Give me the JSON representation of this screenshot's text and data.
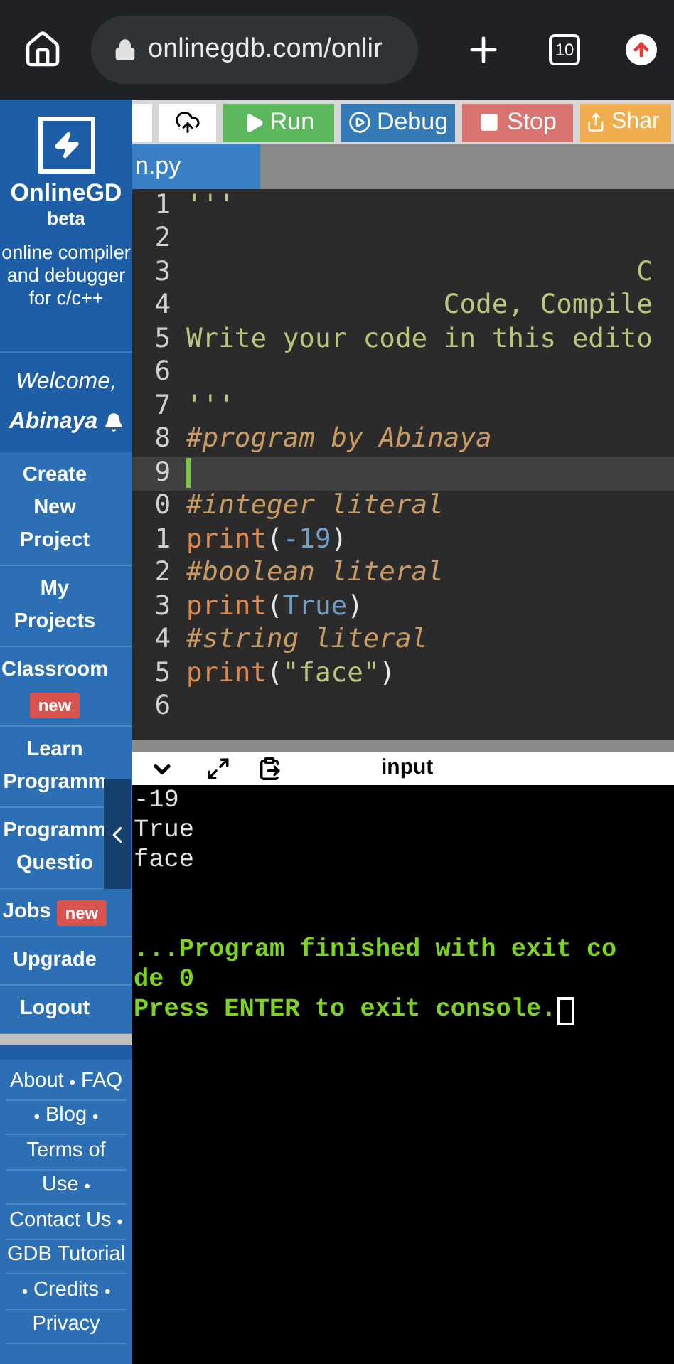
{
  "browser": {
    "url": "onlinegdb.com/onlir",
    "tab_count": "10"
  },
  "sidebar": {
    "logo_title": "OnlineGD",
    "logo_subtitle": "beta",
    "tagline": "online compiler and debugger for c/c++",
    "welcome": "Welcome,",
    "user": "Abinaya",
    "menu": [
      {
        "label": "Create New Project"
      },
      {
        "label": "My Projects"
      },
      {
        "label": "Classroom",
        "badge": "new",
        "badge_inline": false
      },
      {
        "label": "Learn Programm"
      },
      {
        "label": "Programm Questio"
      },
      {
        "label": "Jobs",
        "badge": "new",
        "badge_inline": true
      },
      {
        "label": "Upgrade"
      },
      {
        "label": "Logout"
      }
    ],
    "footer_lines": [
      [
        {
          "kind": "link",
          "text": "About"
        },
        {
          "kind": "sep",
          "text": "•"
        },
        {
          "kind": "link",
          "text": "FAQ"
        }
      ],
      [
        {
          "kind": "sep",
          "text": "•"
        },
        {
          "kind": "link",
          "text": "Blog"
        },
        {
          "kind": "sep",
          "text": "•"
        }
      ],
      [
        {
          "kind": "link",
          "text": "Terms of"
        }
      ],
      [
        {
          "kind": "link",
          "text": "Use"
        },
        {
          "kind": "sep",
          "text": "•"
        }
      ],
      [
        {
          "kind": "link",
          "text": "Contact Us"
        },
        {
          "kind": "sep",
          "text": "•"
        }
      ],
      [
        {
          "kind": "link",
          "text": "GDB Tutorial"
        }
      ],
      [
        {
          "kind": "sep",
          "text": "•"
        },
        {
          "kind": "link",
          "text": "Credits"
        },
        {
          "kind": "sep",
          "text": "•"
        }
      ],
      [
        {
          "kind": "link",
          "text": "Privacy"
        }
      ]
    ]
  },
  "toolbar": [
    {
      "kind": "blank"
    },
    {
      "kind": "upload"
    },
    {
      "kind": "run",
      "label": "Run"
    },
    {
      "kind": "debug",
      "label": "Debug"
    },
    {
      "kind": "stop",
      "label": "Stop"
    },
    {
      "kind": "share",
      "label": "Shar"
    }
  ],
  "file_tab": "n.py",
  "editor": {
    "lines": [
      {
        "number": "1",
        "active": false,
        "tokens": [
          {
            "kind": "doc",
            "text": "'''"
          }
        ]
      },
      {
        "number": "2",
        "active": false
      },
      {
        "number": "3",
        "active": false,
        "tokens": [
          {
            "kind": "doc",
            "text": "                            C"
          }
        ]
      },
      {
        "number": "4",
        "active": false,
        "tokens": [
          {
            "kind": "doc",
            "text": "                Code, Compile"
          }
        ]
      },
      {
        "number": "5",
        "active": false,
        "tokens": [
          {
            "kind": "doc",
            "text": "Write your code in this edito"
          }
        ]
      },
      {
        "number": "6",
        "active": false
      },
      {
        "number": "7",
        "active": false,
        "tokens": [
          {
            "kind": "doc",
            "text": "'''"
          }
        ]
      },
      {
        "number": "8",
        "active": false,
        "tokens": [
          {
            "kind": "comment",
            "text": "#program by Abinaya"
          }
        ]
      },
      {
        "number": "9",
        "active": true
      },
      {
        "number": "0",
        "active": false,
        "tokens": [
          {
            "kind": "comment",
            "text": "#integer literal"
          }
        ]
      },
      {
        "number": "1",
        "active": false,
        "tokens": [
          {
            "kind": "keyword",
            "text": "print"
          },
          {
            "kind": "plain",
            "text": "("
          },
          {
            "kind": "number",
            "text": "-19"
          },
          {
            "kind": "plain",
            "text": ")"
          }
        ]
      },
      {
        "number": "2",
        "active": false,
        "tokens": [
          {
            "kind": "comment",
            "text": "#boolean literal"
          }
        ]
      },
      {
        "number": "3",
        "active": false,
        "tokens": [
          {
            "kind": "keyword",
            "text": "print"
          },
          {
            "kind": "plain",
            "text": "("
          },
          {
            "kind": "number",
            "text": "True"
          },
          {
            "kind": "plain",
            "text": ")"
          }
        ]
      },
      {
        "number": "4",
        "active": false,
        "tokens": [
          {
            "kind": "comment",
            "text": "#string literal"
          }
        ]
      },
      {
        "number": "5",
        "active": false,
        "tokens": [
          {
            "kind": "keyword",
            "text": "print"
          },
          {
            "kind": "plain",
            "text": "("
          },
          {
            "kind": "string",
            "text": "\"face\""
          },
          {
            "kind": "plain",
            "text": ")"
          }
        ]
      },
      {
        "number": "6",
        "active": false
      }
    ]
  },
  "console": {
    "tab_label": "input",
    "output": [
      {
        "kind": "stdout",
        "text": "-19"
      },
      {
        "kind": "stdout",
        "text": "True"
      },
      {
        "kind": "stdout",
        "text": "face"
      },
      {
        "kind": "blank"
      },
      {
        "kind": "blank"
      },
      {
        "kind": "status",
        "text": "...Program finished with exit co"
      },
      {
        "kind": "status",
        "text": "de 0"
      },
      {
        "kind": "prompt",
        "text": "Press ENTER to exit console."
      }
    ]
  }
}
